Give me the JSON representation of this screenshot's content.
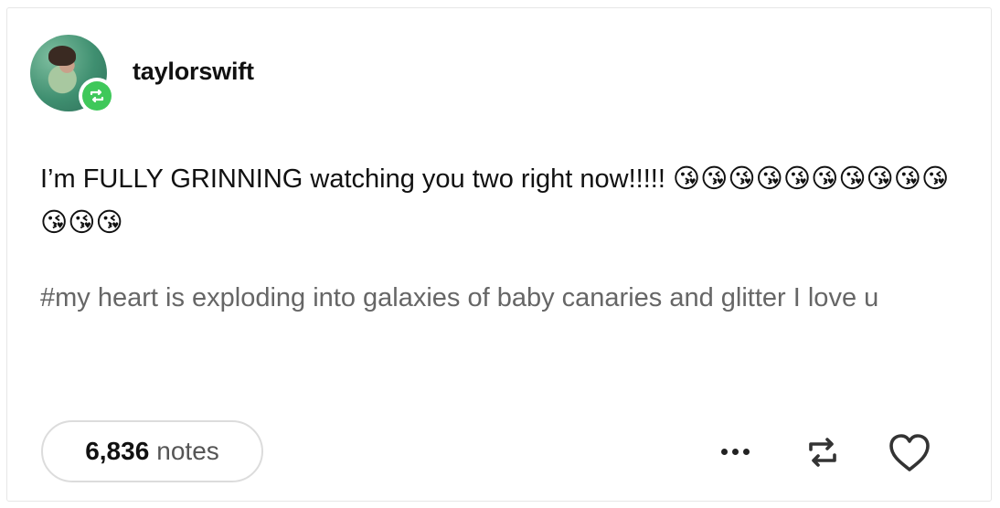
{
  "post": {
    "username": "taylorswift",
    "body": "I’m FULLY GRINNING watching you two right now!!!!! 😘😘😘😘😘😘😘😘😘😘😘😘😘",
    "tags": "#my heart is exploding into galaxies of baby canaries and glitter I love u"
  },
  "footer": {
    "notes_count": "6,836",
    "notes_label": "notes"
  },
  "icons": {
    "badge": "reblog-icon",
    "more": "more-options-icon",
    "reblog": "reblog-icon",
    "like": "heart-icon"
  },
  "colors": {
    "badge_green": "#3fc85a",
    "text": "#111111",
    "tag_text": "#666666"
  }
}
